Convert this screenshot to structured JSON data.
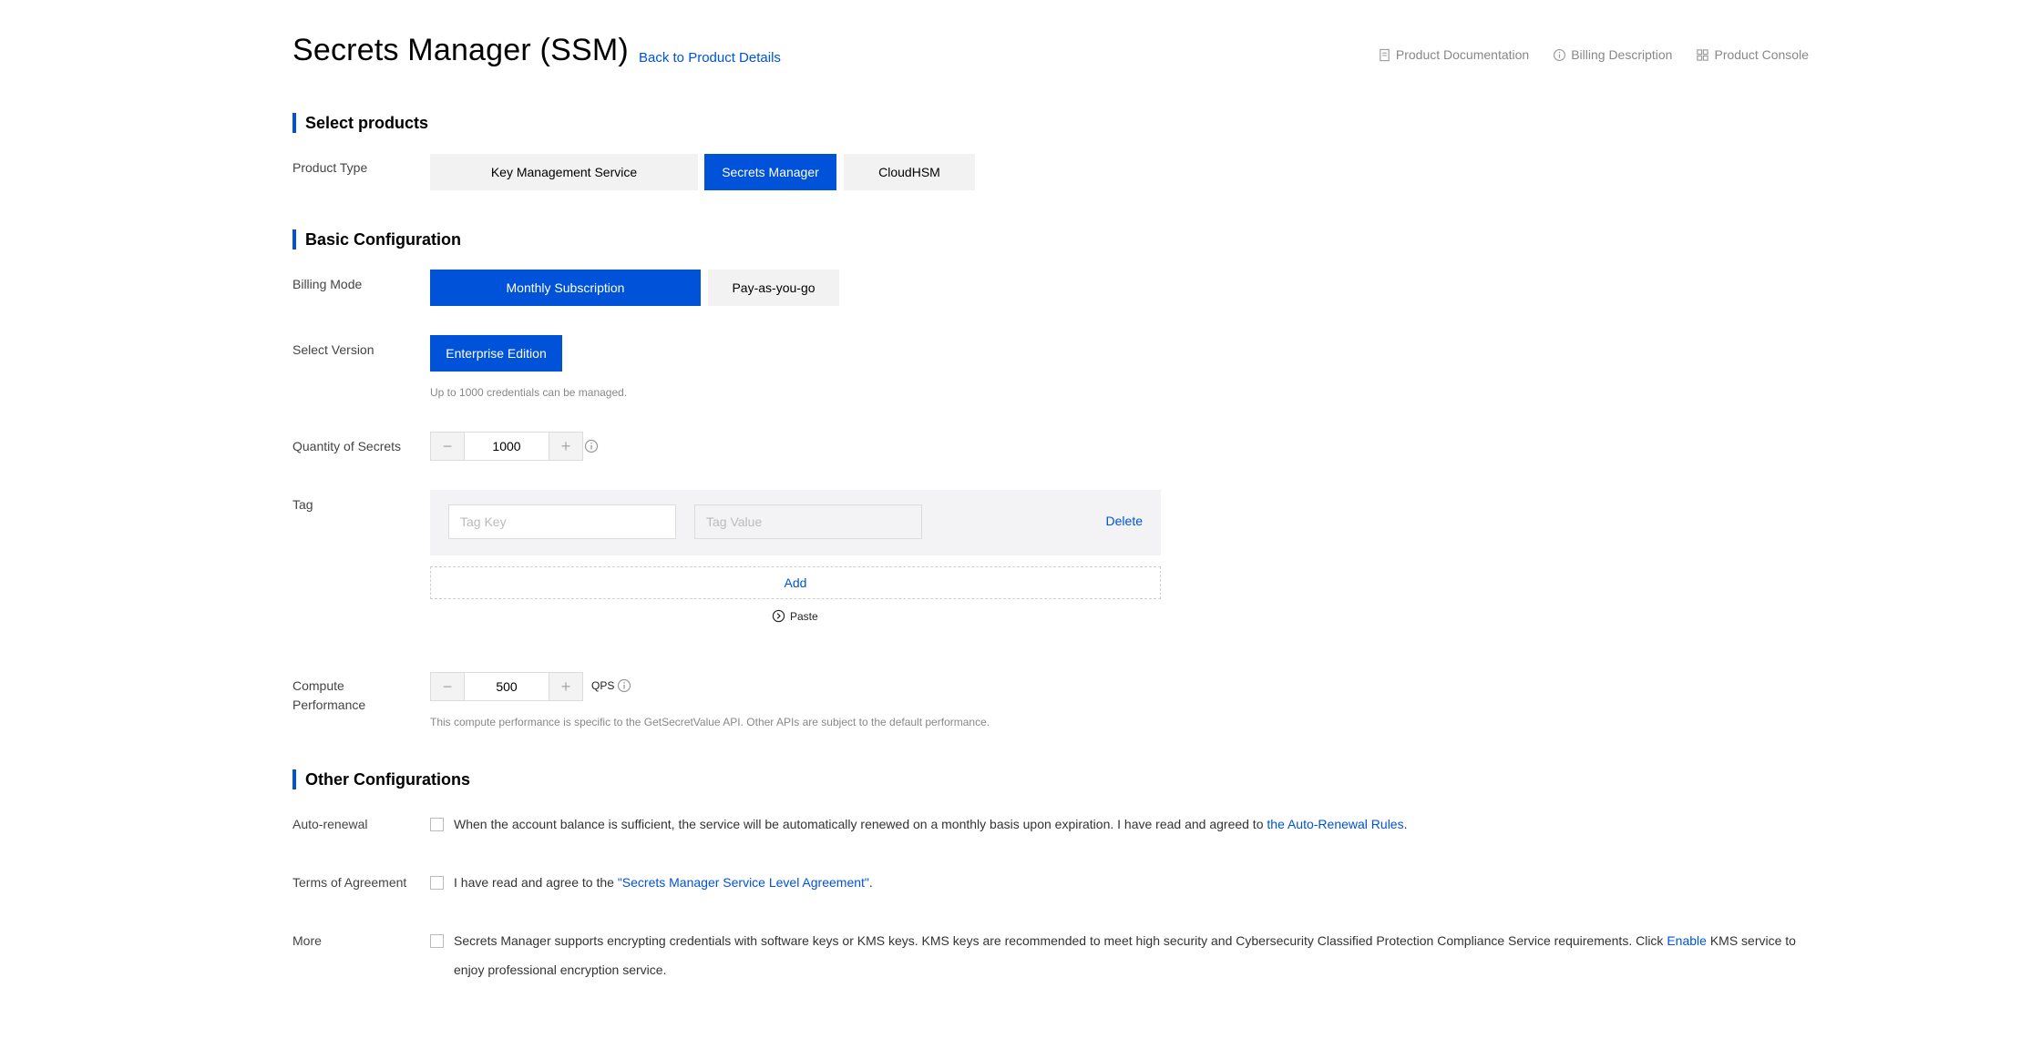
{
  "header": {
    "title": "Secrets Manager (SSM)",
    "back_link": "Back to Product Details",
    "links": [
      {
        "label": "Product Documentation",
        "icon": "document-icon"
      },
      {
        "label": "Billing Description",
        "icon": "info-icon"
      },
      {
        "label": "Product Console",
        "icon": "grid-icon"
      }
    ]
  },
  "select_products": {
    "title": "Select products",
    "product_type_label": "Product Type",
    "options": [
      "Key Management Service",
      "Secrets Manager",
      "CloudHSM"
    ],
    "selected": "Secrets Manager"
  },
  "basic_config": {
    "title": "Basic Configuration",
    "billing_mode_label": "Billing Mode",
    "billing_options": [
      "Monthly Subscription",
      "Pay-as-you-go"
    ],
    "billing_selected": "Monthly Subscription",
    "version_label": "Select Version",
    "version_option": "Enterprise Edition",
    "version_hint": "Up to 1000 credentials can be managed.",
    "quantity_label": "Quantity of Secrets",
    "quantity_value": "1000",
    "tag_label": "Tag",
    "tag_key_placeholder": "Tag Key",
    "tag_value_placeholder": "Tag Value",
    "tag_delete": "Delete",
    "tag_add": "Add",
    "tag_paste": "Paste",
    "compute_label_line1": "Compute",
    "compute_label_line2": "Performance",
    "compute_value": "500",
    "compute_unit": "QPS",
    "compute_hint": "This compute performance is specific to the GetSecretValue API. Other APIs are subject to the default performance."
  },
  "other_config": {
    "title": "Other Configurations",
    "auto_renewal_label": "Auto-renewal",
    "auto_renewal_text": "When the account balance is sufficient, the service will be automatically renewed on a monthly basis upon expiration. I have read and agreed to",
    "auto_renewal_link": "the Auto-Renewal Rules",
    "auto_renewal_end": ".",
    "terms_label": "Terms of Agreement",
    "terms_text": "I have read and agree to the",
    "terms_link": "\"Secrets Manager Service Level Agreement\"",
    "terms_end": ".",
    "more_label": "More",
    "more_text": "Secrets Manager supports encrypting credentials with software keys or KMS keys. KMS keys are recommended to meet high security and Cybersecurity Classified Protection Compliance Service requirements. Click",
    "more_link": "Enable",
    "more_end": "KMS service to enjoy professional encryption service."
  },
  "colors": {
    "accent": "#0052d9",
    "tab_grey": "#f2f2f2",
    "tag_bg": "#f3f3f5"
  }
}
